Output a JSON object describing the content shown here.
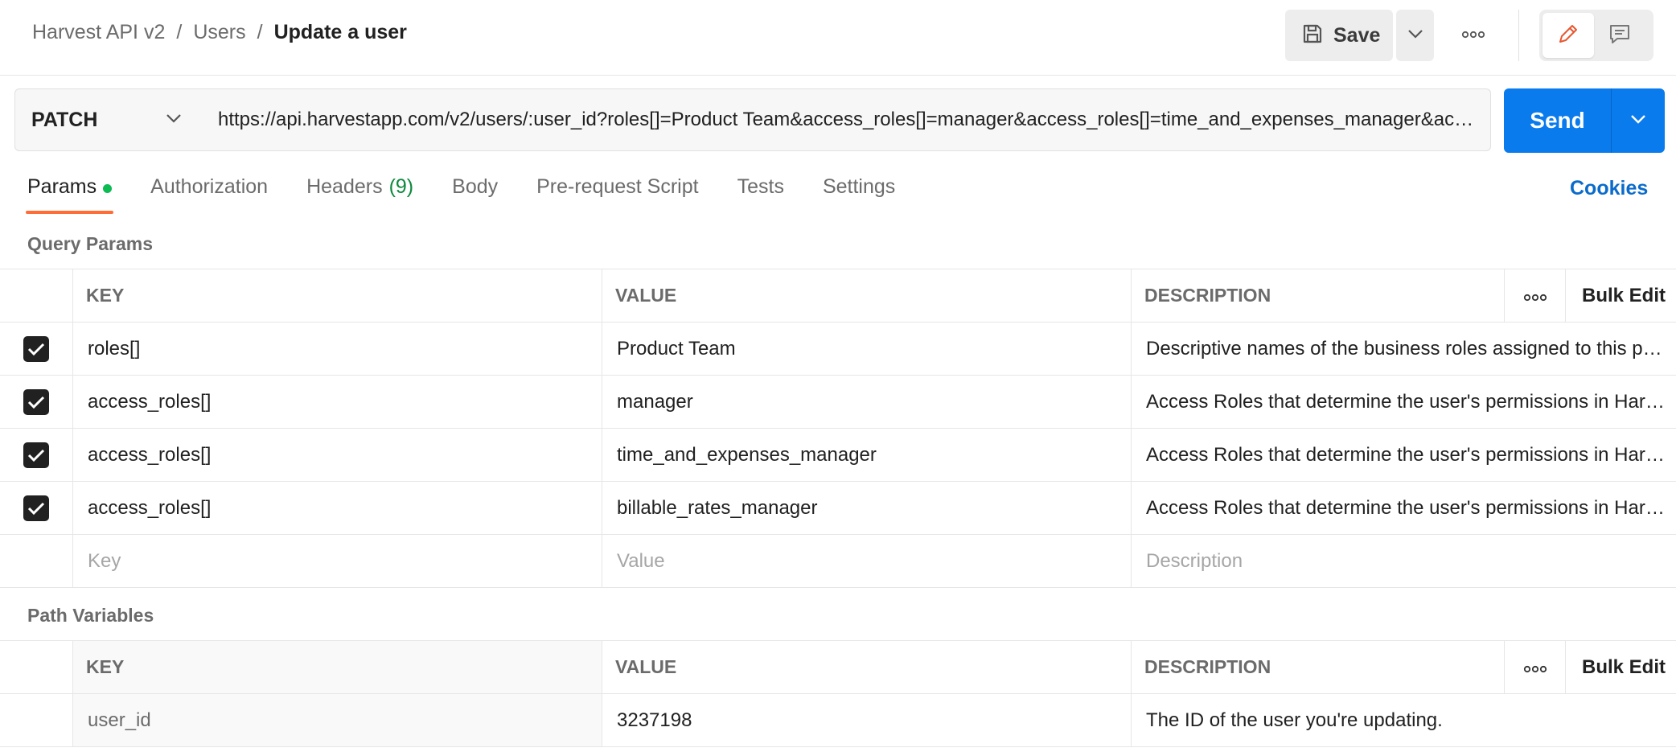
{
  "breadcrumb": {
    "items": [
      "Harvest API v2",
      "Users"
    ],
    "separator": "/",
    "current": "Update a user"
  },
  "toolbar": {
    "save_label": "Save"
  },
  "request": {
    "method": "PATCH",
    "url": "https://api.harvestapp.com/v2/users/:user_id?roles[]=Product Team&access_roles[]=manager&access_roles[]=time_and_expenses_manager&access_roles[]=billable_rates_manager",
    "send_label": "Send"
  },
  "tabs": {
    "params": "Params",
    "authorization": "Authorization",
    "headers": "Headers",
    "headers_count": "(9)",
    "body": "Body",
    "prerequest": "Pre-request Script",
    "tests": "Tests",
    "settings": "Settings",
    "cookies": "Cookies"
  },
  "query_params": {
    "title": "Query Params",
    "columns": {
      "key": "KEY",
      "value": "VALUE",
      "description": "DESCRIPTION",
      "bulk_edit": "Bulk Edit"
    },
    "rows": [
      {
        "key": "roles[]",
        "value": "Product Team",
        "description": "Descriptive names of the business roles assigned to this person.",
        "checked": true
      },
      {
        "key": "access_roles[]",
        "value": "manager",
        "description": "Access Roles that determine the user's permissions in Harvest.",
        "checked": true
      },
      {
        "key": "access_roles[]",
        "value": "time_and_expenses_manager",
        "description": "Access Roles that determine the user's permissions in Harvest.",
        "checked": true
      },
      {
        "key": "access_roles[]",
        "value": "billable_rates_manager",
        "description": "Access Roles that determine the user's permissions in Harvest.",
        "checked": true
      }
    ],
    "placeholders": {
      "key": "Key",
      "value": "Value",
      "description": "Description"
    }
  },
  "path_variables": {
    "title": "Path Variables",
    "columns": {
      "key": "KEY",
      "value": "VALUE",
      "description": "DESCRIPTION",
      "bulk_edit": "Bulk Edit"
    },
    "rows": [
      {
        "key": "user_id",
        "value": "3237198",
        "description": "The ID of the user you're updating."
      }
    ]
  },
  "colors": {
    "send": "#097bed",
    "active_tab_underline": "#ff6c37",
    "params_dot": "#0cbb52",
    "cookies_link": "#0b6bcb"
  }
}
